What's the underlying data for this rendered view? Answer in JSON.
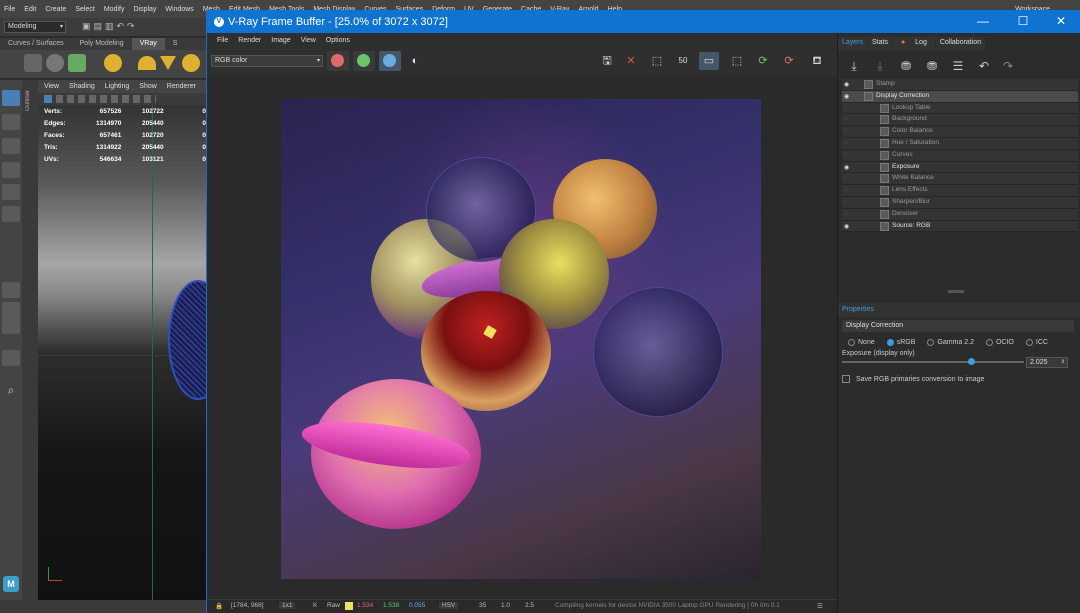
{
  "maya": {
    "menu": [
      "File",
      "Edit",
      "Create",
      "Select",
      "Modify",
      "Display",
      "Windows",
      "Mesh",
      "Edit Mesh",
      "Mesh Tools",
      "Mesh Display",
      "Curves",
      "Surfaces",
      "Deform",
      "UV",
      "Generate",
      "Cache",
      "V-Ray",
      "Arnold",
      "Help",
      "Workspace"
    ],
    "workspace_value": "Modeling",
    "shelf_tabs": [
      "Curves / Surfaces",
      "Poly Modeling",
      "VRay",
      "S"
    ],
    "viewport_menu": [
      "View",
      "Shading",
      "Lighting",
      "Show",
      "Renderer"
    ],
    "stats": [
      {
        "label": "Verts:",
        "a": "657526",
        "b": "102722",
        "c": "0"
      },
      {
        "label": "Edges:",
        "a": "1314970",
        "b": "205440",
        "c": "0"
      },
      {
        "label": "Faces:",
        "a": "657461",
        "b": "102720",
        "c": "0"
      },
      {
        "label": "Tris:",
        "a": "1314922",
        "b": "205440",
        "c": "0"
      },
      {
        "label": "UVs:",
        "a": "546634",
        "b": "103121",
        "c": "0"
      }
    ],
    "outliner_label": "Outliner",
    "logo_text": "M"
  },
  "vfb": {
    "title": "V-Ray Frame Buffer - [25.0% of 3072 x 3072]",
    "menu": [
      "File",
      "Render",
      "Image",
      "View",
      "Options"
    ],
    "channel": "RGB color",
    "colors": {
      "red": "#e06a6a",
      "green": "#6ac46a",
      "blue": "#6aaee0",
      "accent": "#0f73d1"
    },
    "status": {
      "coords": "[1784, 968]",
      "zoom": "1x1",
      "mode": "Raw",
      "r": "1.534",
      "g": "1.538",
      "b": "0.055",
      "space": "HSV",
      "v1": "35",
      "v2": "1.0",
      "v3": "2.5",
      "message": "Compiling kernels for device NVIDIA 3500 Laptop GPU Rendering [ 0h 0m 0.1"
    }
  },
  "panel": {
    "tabs": [
      "Layers",
      "Stats",
      "Log",
      "Collaboration"
    ],
    "layers": [
      {
        "name": "Stamp",
        "eye": true,
        "on": false,
        "indent": 0
      },
      {
        "name": "Display Correction",
        "eye": true,
        "on": true,
        "indent": 0,
        "selected": true
      },
      {
        "name": "Lookup Table",
        "eye": false,
        "on": false,
        "indent": 1
      },
      {
        "name": "Background",
        "eye": false,
        "on": false,
        "indent": 1
      },
      {
        "name": "Color Balance",
        "eye": false,
        "on": false,
        "indent": 1
      },
      {
        "name": "Hue / Saturation",
        "eye": false,
        "on": false,
        "indent": 1
      },
      {
        "name": "Curves",
        "eye": false,
        "on": false,
        "indent": 1
      },
      {
        "name": "Exposure",
        "eye": true,
        "on": true,
        "indent": 1
      },
      {
        "name": "White Balance",
        "eye": false,
        "on": false,
        "indent": 1
      },
      {
        "name": "Lens Effects",
        "eye": false,
        "on": false,
        "indent": 1
      },
      {
        "name": "Sharpen/Blur",
        "eye": false,
        "on": false,
        "indent": 1
      },
      {
        "name": "Denoiser",
        "eye": false,
        "on": false,
        "indent": 1
      },
      {
        "name": "Source: RGB",
        "eye": true,
        "on": true,
        "indent": 1
      }
    ],
    "properties_title": "Properties",
    "section_title": "Display Correction",
    "radio_options": [
      {
        "label": "None",
        "on": false
      },
      {
        "label": "sRGB",
        "on": true
      },
      {
        "label": "Gamma 2.2",
        "on": false
      },
      {
        "label": "OCIO",
        "on": false
      },
      {
        "label": "ICC",
        "on": false
      }
    ],
    "exposure_label": "Exposure (display only)",
    "exposure_value": "2.025",
    "exposure_fraction": 0.71,
    "save_rgb_label": "Save RGB primaries conversion to image"
  }
}
